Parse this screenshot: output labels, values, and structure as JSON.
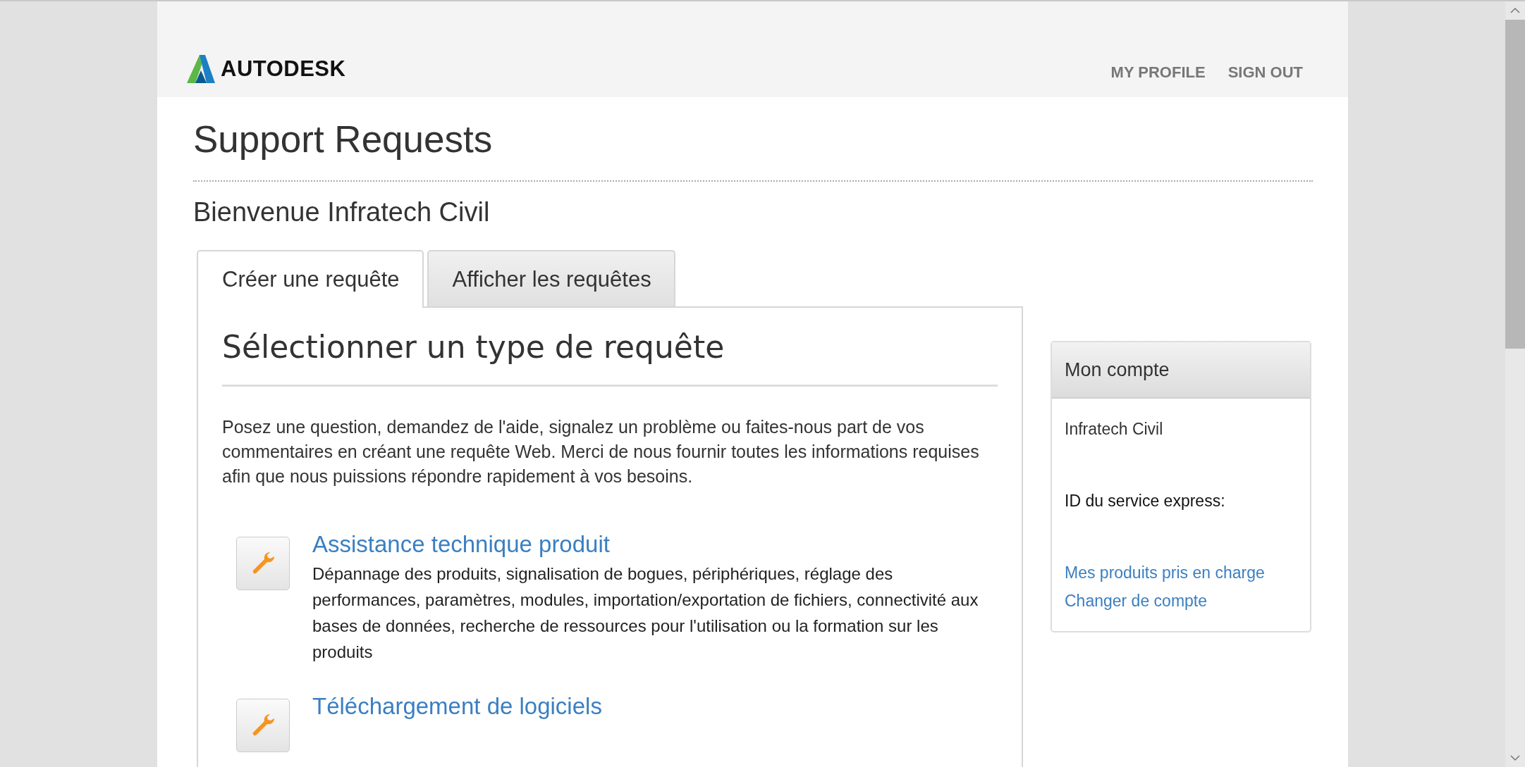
{
  "header": {
    "logo": "AUTODESK",
    "links": [
      "MY PROFILE",
      "SIGN OUT"
    ]
  },
  "title": "Support Requests",
  "welcome": "Bienvenue Infratech Civil",
  "tabs": [
    {
      "label": "Créer une requête",
      "selected": true
    },
    {
      "label": "Afficher les requêtes",
      "selected": false
    }
  ],
  "panel": {
    "heading": "Sélectionner un type de requête",
    "intro": "Posez une question, demandez de l'aide, signalez un problème ou faites-nous part de vos commentaires en créant une requête Web. Merci de nous fournir toutes les informations requises afin que nous puissions répondre rapidement à vos besoins.",
    "request_types": [
      {
        "title": "Assistance technique produit",
        "description": "Dépannage des produits, signalisation de bogues, périphériques, réglage des performances, paramètres, modules, importation/exportation de fichiers, connectivité aux bases de données, recherche de ressources pour l'utilisation ou la formation sur les produits"
      },
      {
        "title": "Téléchargement de logiciels"
      }
    ]
  },
  "account": {
    "title": "Mon compte",
    "name": "Infratech Civil",
    "express_id_label": "ID du service express:",
    "links": [
      "Mes produits pris en charge",
      "Changer de compte"
    ]
  }
}
